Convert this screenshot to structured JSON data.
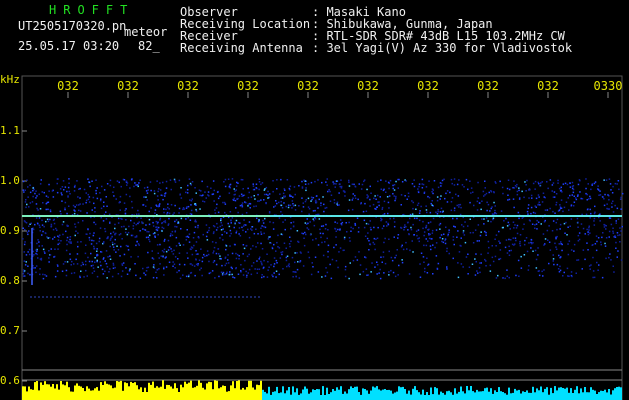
{
  "header": {
    "app_name": "HROFFT",
    "filename": "UT2505170320.pn",
    "mode_label": "meteor",
    "datetime": "25.05.17 03:20",
    "count": "82_",
    "fields": [
      {
        "label": "Observer",
        "value": ": Masaki Kano"
      },
      {
        "label": "Receiving Location",
        "value": ": Shibukawa, Gunma, Japan"
      },
      {
        "label": "Receiver",
        "value": ": RTL-SDR SDR# 43dB L15 103.2MHz CW"
      },
      {
        "label": "Receiving Antenna",
        "value": ": 3el Yagi(V) Az 330 for Vladivostok"
      }
    ]
  },
  "axis": {
    "unit": "kHz",
    "ticks": [
      "1.1",
      "1.0",
      "0.9",
      "0.8",
      "0.7",
      "0.6"
    ]
  },
  "time_labels": [
    "032",
    "032",
    "032",
    "032",
    "032",
    "032",
    "032",
    "032",
    "032",
    "0330"
  ],
  "colors": {
    "background": "#000000",
    "header_green": "#22e022",
    "header_text": "#f0f0f0",
    "axis_text": "#e6e600",
    "signal_line": "#64ffff",
    "noise_blue": "#2040ff",
    "power_yellow": "#ffff00",
    "power_cyan": "#00e0ff"
  }
}
